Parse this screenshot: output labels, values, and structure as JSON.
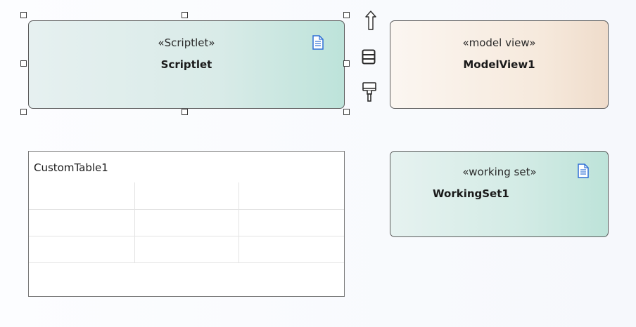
{
  "diagram": {
    "elements": [
      {
        "id": "scriptlet",
        "stereotype": "«Scriptlet»",
        "name": "Scriptlet",
        "icon": "document-icon",
        "selected": true
      },
      {
        "id": "modelview",
        "stereotype": "«model view»",
        "name": "ModelView1"
      },
      {
        "id": "workingset",
        "stereotype": "«working set»",
        "name": "WorkingSet1",
        "icon": "document-icon"
      }
    ],
    "custom_table": {
      "title": "CustomTable1",
      "columns": 3,
      "rows": 4
    }
  },
  "quick_toolbar": [
    "quick-linker-arrow-icon",
    "properties-list-icon",
    "format-painter-icon"
  ],
  "colors": {
    "scriptlet_fill": "#d9ebe8",
    "modelview_fill": "#f6e9dc",
    "workingset_fill": "#d3ebe5",
    "document_icon": "#2e6fd6"
  }
}
